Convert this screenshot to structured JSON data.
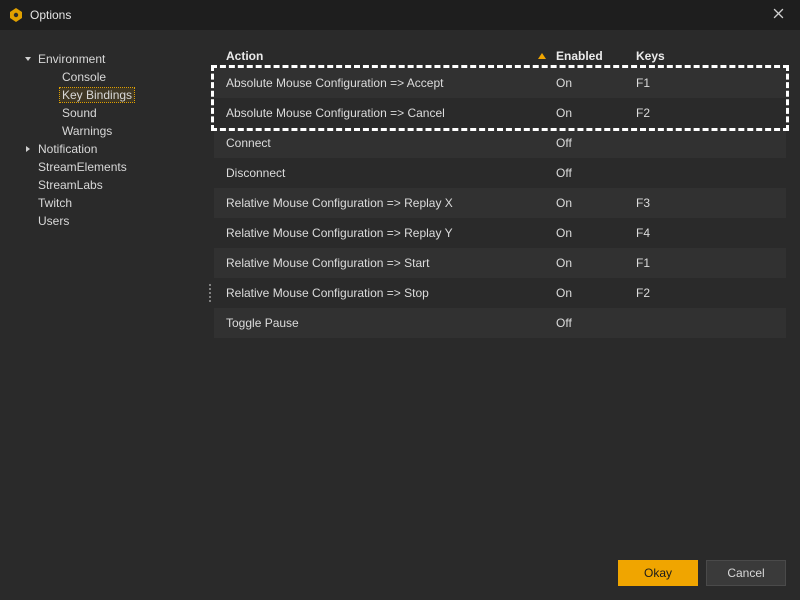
{
  "window": {
    "title": "Options"
  },
  "sidebar": {
    "items": [
      {
        "label": "Environment",
        "depth": 0,
        "expandable": true,
        "expanded": true,
        "selected": false
      },
      {
        "label": "Console",
        "depth": 1,
        "expandable": false,
        "selected": false
      },
      {
        "label": "Key Bindings",
        "depth": 1,
        "expandable": false,
        "selected": true
      },
      {
        "label": "Sound",
        "depth": 1,
        "expandable": false,
        "selected": false
      },
      {
        "label": "Warnings",
        "depth": 1,
        "expandable": false,
        "selected": false
      },
      {
        "label": "Notification",
        "depth": 0,
        "expandable": true,
        "expanded": false,
        "selected": false
      },
      {
        "label": "StreamElements",
        "depth": 0,
        "expandable": false,
        "selected": false
      },
      {
        "label": "StreamLabs",
        "depth": 0,
        "expandable": false,
        "selected": false
      },
      {
        "label": "Twitch",
        "depth": 0,
        "expandable": false,
        "selected": false
      },
      {
        "label": "Users",
        "depth": 0,
        "expandable": false,
        "selected": false
      }
    ]
  },
  "table": {
    "headers": {
      "action": "Action",
      "enabled": "Enabled",
      "keys": "Keys"
    },
    "sort_column": "action",
    "sort_dir": "asc",
    "rows": [
      {
        "action": "Absolute Mouse Configuration => Accept",
        "enabled": "On",
        "keys": "F1",
        "highlight": true
      },
      {
        "action": "Absolute Mouse Configuration => Cancel",
        "enabled": "On",
        "keys": "F2",
        "highlight": true
      },
      {
        "action": "Connect",
        "enabled": "Off",
        "keys": ""
      },
      {
        "action": "Disconnect",
        "enabled": "Off",
        "keys": ""
      },
      {
        "action": "Relative Mouse Configuration => Replay X",
        "enabled": "On",
        "keys": "F3"
      },
      {
        "action": "Relative Mouse Configuration => Replay Y",
        "enabled": "On",
        "keys": "F4"
      },
      {
        "action": "Relative Mouse Configuration => Start",
        "enabled": "On",
        "keys": "F1"
      },
      {
        "action": "Relative Mouse Configuration => Stop",
        "enabled": "On",
        "keys": "F2",
        "drag_handle": true
      },
      {
        "action": "Toggle Pause",
        "enabled": "Off",
        "keys": ""
      }
    ]
  },
  "footer": {
    "okay": "Okay",
    "cancel": "Cancel"
  },
  "colors": {
    "accent": "#f0a500",
    "bg": "#2a2a2a",
    "bg_dark": "#1e1e1e",
    "row_alt": "#313131"
  }
}
